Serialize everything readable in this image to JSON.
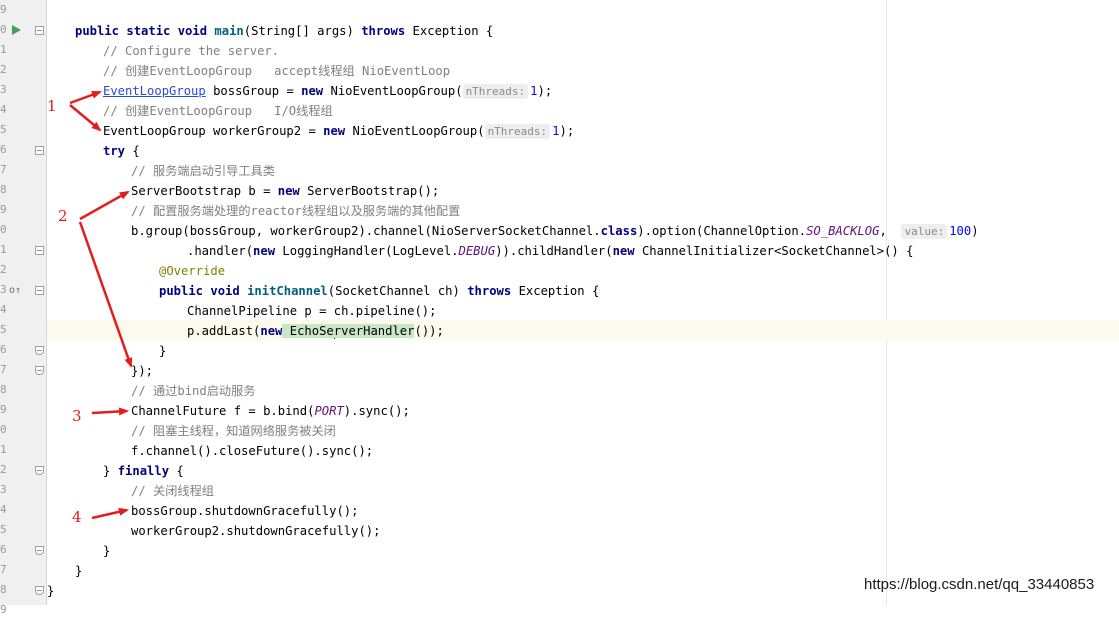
{
  "gutter": {
    "line_digits": [
      "9",
      "0",
      "1",
      "2",
      "3",
      "4",
      "5",
      "6",
      "7",
      "8",
      "9",
      "0",
      "1",
      "2",
      "3",
      "4",
      "5",
      "6",
      "7",
      "8",
      "9",
      "0",
      "1",
      "2",
      "3",
      "4",
      "5",
      "6",
      "7",
      "8",
      "9"
    ]
  },
  "code": {
    "l1": {
      "kw1": "public static void ",
      "name": "main",
      "sig": "(String[] args) ",
      "kw2": "throws",
      "rest": " Exception {"
    },
    "l2": {
      "comment": "// Configure the server."
    },
    "l3": {
      "comment": "// 创建EventLoopGroup   accept线程组 NioEventLoop"
    },
    "l4": {
      "type": "EventLoopGroup",
      "var": " bossGroup = ",
      "kw": "new",
      "ctor": " NioEventLoopGroup(",
      "hint": "nThreads:",
      "num": "1",
      "end": ");"
    },
    "l5": {
      "comment": "// 创建EventLoopGroup   I/O线程组"
    },
    "l6": {
      "pre": "EventLoopGroup workerGroup2 = ",
      "kw": "new",
      "ctor": " NioEventLoopGroup(",
      "hint": "nThreads:",
      "num": "1",
      "end": ");"
    },
    "l7": {
      "kw": "try",
      "rest": " {"
    },
    "l8": {
      "comment": "// 服务端启动引导工具类"
    },
    "l9": {
      "pre": "ServerBootstrap b = ",
      "kw": "new",
      "rest": " ServerBootstrap();"
    },
    "l10": {
      "comment": "// 配置服务端处理的reactor线程组以及服务端的其他配置"
    },
    "l11": {
      "pre": "b.group(bossGroup, workerGroup2).channel(NioServerSocketChannel.",
      "kw": "class",
      "mid": ").option(ChannelOption.",
      "const": "SO_BACKLOG",
      "sep": ",  ",
      "hint": "value:",
      "num": "100",
      "end": ")"
    },
    "l12": {
      "pre": ".handler(",
      "kw": "new",
      "mid": " LoggingHandler(LogLevel.",
      "const": "DEBUG",
      "mid2": ")).childHandler(",
      "kw2": "new",
      "end": " ChannelInitializer<SocketChannel>() {"
    },
    "l13": {
      "ann": "@Override"
    },
    "l14": {
      "kw1": "public void ",
      "name": "initChannel",
      "sig": "(SocketChannel ch) ",
      "kw2": "throws",
      "rest": " Exception {"
    },
    "l15": {
      "text": "ChannelPipeline p = ch.pipeline();"
    },
    "l16": {
      "pre": "p.addLast(",
      "kw": "new",
      "cls_a": " EchoSe",
      "cls_b": "rverHandler",
      "end": "());"
    },
    "l17": {
      "text": "}"
    },
    "l18": {
      "text": "});"
    },
    "l19": {
      "comment": "// 通过bind启动服务"
    },
    "l20": {
      "pre": "ChannelFuture f = b.bind(",
      "const": "PORT",
      "end": ").sync();"
    },
    "l21": {
      "comment": "// 阻塞主线程，知道网络服务被关闭"
    },
    "l22": {
      "text": "f.channel().closeFuture().sync();"
    },
    "l23": {
      "pre": "} ",
      "kw": "finally",
      "end": " {"
    },
    "l24": {
      "comment": "// 关闭线程组"
    },
    "l25": {
      "text": "bossGroup.shutdownGracefully();"
    },
    "l26": {
      "text": "workerGroup2.shutdownGracefully();"
    },
    "l27": {
      "text": "}"
    },
    "l28": {
      "text": "}"
    },
    "l29": {
      "text": "}"
    }
  },
  "annotations": {
    "labels": [
      "1",
      "2",
      "3",
      "4"
    ],
    "color": "#e51c1c"
  },
  "watermark": "https://blog.csdn.net/qq_33440853"
}
